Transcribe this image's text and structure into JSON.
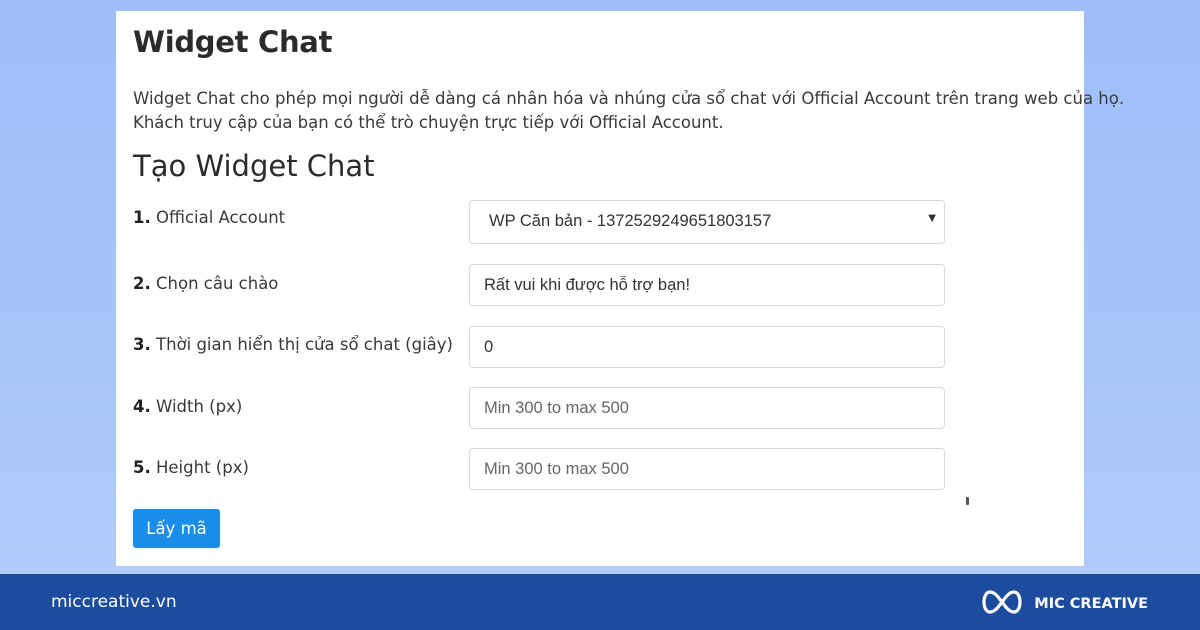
{
  "card": {
    "title": "Widget Chat",
    "description_lines": [
      "Widget Chat cho phép mọi người dễ dàng cá nhân hóa và nhúng cửa sổ chat với Official Account trên trang web của họ.",
      "Khách truy cập của bạn có thể trò chuyện trực tiếp với Official Account."
    ],
    "section_title": "Tạo Widget Chat"
  },
  "form": {
    "fields": [
      {
        "number": "1.",
        "label": "Official Account",
        "type": "select",
        "value": "WP Căn bản - 1372529249651803157"
      },
      {
        "number": "2.",
        "label": "Chọn câu chào",
        "type": "text",
        "value": "Rất vui khi được hỗ trợ bạn!"
      },
      {
        "number": "3.",
        "label": "Thời gian hiển thị cửa sổ chat (giây)",
        "type": "text",
        "value": "0"
      },
      {
        "number": "4.",
        "label": "Width (px)",
        "type": "text",
        "value": "",
        "placeholder": "Min 300 to max 500"
      },
      {
        "number": "5.",
        "label": "Height (px)",
        "type": "text",
        "value": "",
        "placeholder": "Min 300 to max 500"
      }
    ],
    "submit_label": "Lấy mã"
  },
  "footer": {
    "site_url": "miccreative.vn",
    "brand_name": "MIC CREATIVE",
    "logo_icon": "infinity-loop-icon"
  },
  "colors": {
    "background": "#a9c6fa",
    "footer": "#1c4c9e",
    "button": "#1a8de8"
  }
}
